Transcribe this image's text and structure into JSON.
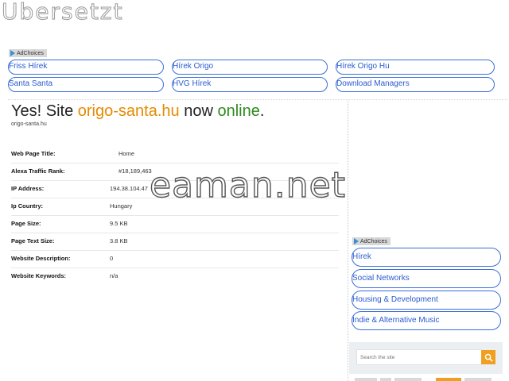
{
  "brand": "Ubersetzt",
  "adchoices": "AdChoices",
  "top_links": [
    "Friss Hírek",
    "Hírek Origo",
    "Hírek Origo Hu",
    "Santa Santa",
    "HVG Hírek",
    "Download Managers"
  ],
  "headline": {
    "prefix": "Yes! Site",
    "domain": "origo-santa.hu",
    "middle": "now",
    "status": "online",
    "suffix": "."
  },
  "subdomain": "origo-santa.hu",
  "info_rows": [
    {
      "label": "Web Page Title:",
      "value": "Home"
    },
    {
      "label": "Alexa Traffic Rank:",
      "value": "#18,189,463"
    },
    {
      "label": "IP Address:",
      "value": "194.38.104.47"
    },
    {
      "label": "Ip Country:",
      "value": "Hungary"
    },
    {
      "label": "Page Size:",
      "value": "9.5 KB"
    },
    {
      "label": "Page Text Size:",
      "value": "3.8 KB"
    },
    {
      "label": "Website Description:",
      "value": "0"
    },
    {
      "label": "Website Keywords:",
      "value": "n/a"
    }
  ],
  "watermark": "eaman.net",
  "side_links": [
    "Hírek",
    "Social Networks",
    "Housing & Development",
    "Indie & Alternative Music"
  ],
  "search": {
    "placeholder": "Search the site"
  },
  "colors": {
    "link": "#2a5bd0",
    "domain": "#e68a00",
    "online": "#2f8a1f",
    "search_button": "#f0a020"
  }
}
